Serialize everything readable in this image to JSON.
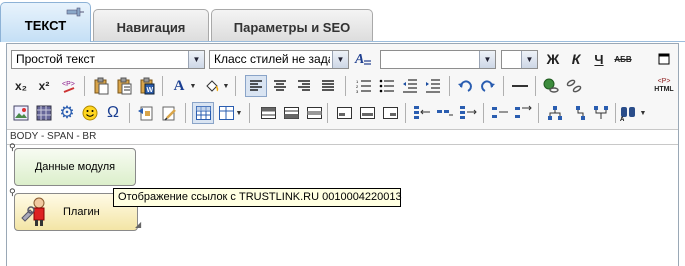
{
  "tabs": [
    {
      "label": "ТЕКСТ",
      "active": true
    },
    {
      "label": "Навигация",
      "active": false
    },
    {
      "label": "Параметры и SEO",
      "active": false
    }
  ],
  "toolbar": {
    "format_select": "Простой текст",
    "style_select": "Класс стилей не задан",
    "font_select": "",
    "size_select": "",
    "bold": "Ж",
    "italic": "К",
    "underline": "Ч",
    "strike": "АБВ",
    "subscript": "x₂",
    "superscript": "x²",
    "font_color": "A",
    "special_char": "Ω",
    "html_label": "HTML",
    "html_tag": "<P>"
  },
  "path": "BODY - SPAN - BR",
  "modules": {
    "data_module": "Данные модуля",
    "plugin": "Плагин"
  },
  "tooltip": "Отображение ссылок с TRUSTLINK.RU 0010004220013"
}
